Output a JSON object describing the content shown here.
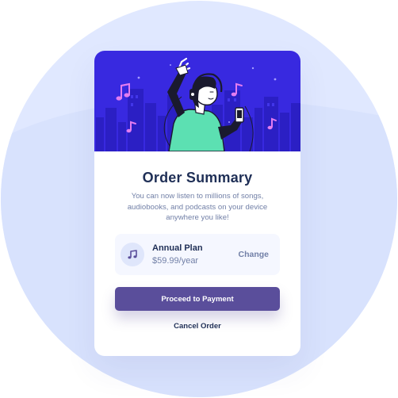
{
  "card": {
    "title": "Order Summary",
    "description": "You can now listen to millions of songs, audiobooks, and podcasts on your device anywhere you like!"
  },
  "plan": {
    "icon": "music-note-icon",
    "name": "Annual Plan",
    "price": "$59.99/year",
    "change_label": "Change"
  },
  "actions": {
    "proceed_label": "Proceed to Payment",
    "cancel_label": "Cancel Order"
  },
  "colors": {
    "page_background": "#e0e8ff",
    "hero_background": "#3829e0",
    "primary_button": "#5a4e9b",
    "heading_text": "#1f2f56",
    "muted_text": "#7280a7",
    "plan_background": "#f5f7ff"
  }
}
